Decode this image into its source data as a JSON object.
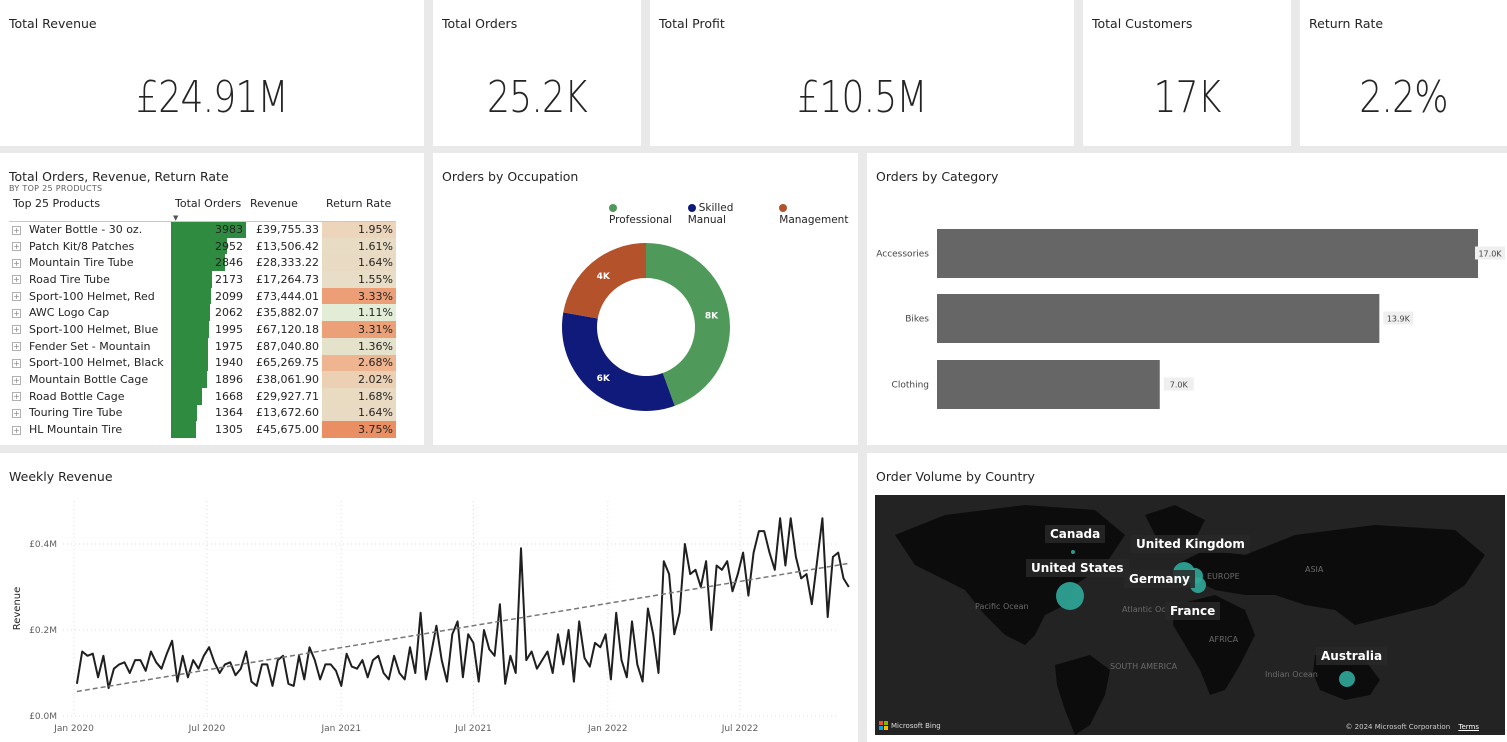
{
  "kpis": [
    {
      "title": "Total Revenue",
      "value": "£24.91M"
    },
    {
      "title": "Total Orders",
      "value": "25.2K"
    },
    {
      "title": "Total Profit",
      "value": "£10.5M"
    },
    {
      "title": "Total Customers",
      "value": "17K"
    },
    {
      "title": "Return Rate",
      "value": "2.2%"
    }
  ],
  "products_table": {
    "title": "Total Orders, Revenue, Return Rate",
    "subtitle": "BY TOP 25 PRODUCTS",
    "columns": [
      "Top 25 Products",
      "Total Orders",
      "Revenue",
      "Return Rate"
    ],
    "max_orders": 3983,
    "rows": [
      {
        "product": "Water Bottle - 30 oz.",
        "orders": 3983,
        "revenue": "£39,755.33",
        "return_rate": "1.95%",
        "rr_color": "#ecd5bb"
      },
      {
        "product": "Patch Kit/8 Patches",
        "orders": 2952,
        "revenue": "£13,506.42",
        "return_rate": "1.61%",
        "rr_color": "#e9dcc4"
      },
      {
        "product": "Mountain Tire Tube",
        "orders": 2846,
        "revenue": "£28,333.22",
        "return_rate": "1.64%",
        "rr_color": "#e9dbc3"
      },
      {
        "product": "Road Tire Tube",
        "orders": 2173,
        "revenue": "£17,264.73",
        "return_rate": "1.55%",
        "rr_color": "#e8ddc6"
      },
      {
        "product": "Sport-100 Helmet, Red",
        "orders": 2099,
        "revenue": "£73,444.01",
        "return_rate": "3.33%",
        "rr_color": "#ec9f77"
      },
      {
        "product": "AWC Logo Cap",
        "orders": 2062,
        "revenue": "£35,882.07",
        "return_rate": "1.11%",
        "rr_color": "#e2ecd6"
      },
      {
        "product": "Sport-100 Helmet, Blue",
        "orders": 1995,
        "revenue": "£67,120.18",
        "return_rate": "3.31%",
        "rr_color": "#eca078"
      },
      {
        "product": "Fender Set - Mountain",
        "orders": 1975,
        "revenue": "£87,040.80",
        "return_rate": "1.36%",
        "rr_color": "#e5e2cc"
      },
      {
        "product": "Sport-100 Helmet, Black",
        "orders": 1940,
        "revenue": "£65,269.75",
        "return_rate": "2.68%",
        "rr_color": "#eeb590"
      },
      {
        "product": "Mountain Bottle Cage",
        "orders": 1896,
        "revenue": "£38,061.90",
        "return_rate": "2.02%",
        "rr_color": "#ecd0b4"
      },
      {
        "product": "Road Bottle Cage",
        "orders": 1668,
        "revenue": "£29,927.71",
        "return_rate": "1.68%",
        "rr_color": "#e9dac2"
      },
      {
        "product": "Touring Tire Tube",
        "orders": 1364,
        "revenue": "£13,672.60",
        "return_rate": "1.64%",
        "rr_color": "#e9dbc3"
      },
      {
        "product": "HL Mountain Tire",
        "orders": 1305,
        "revenue": "£45,675.00",
        "return_rate": "3.75%",
        "rr_color": "#ea8f63"
      }
    ]
  },
  "occupation": {
    "title": "Orders by Occupation",
    "legend": [
      {
        "name": "Professional",
        "color": "#4f9a5a"
      },
      {
        "name": "Skilled Manual",
        "color": "#101a7a"
      },
      {
        "name": "Management",
        "color": "#b4522b"
      }
    ]
  },
  "category": {
    "title": "Orders by Category"
  },
  "weekly": {
    "title": "Weekly Revenue"
  },
  "map": {
    "title": "Order Volume by Country",
    "countries": [
      "Canada",
      "United Kingdom",
      "United States",
      "Germany",
      "France",
      "Australia"
    ],
    "faint_labels": [
      "EUROPE",
      "ASIA",
      "Pacific Ocean",
      "Atlantic Oc",
      "AFRICA",
      "SOUTH AMERICA",
      "Indian Ocean"
    ],
    "attribution": "© 2024 Microsoft Corporation",
    "terms": "Terms",
    "bing": "Microsoft Bing"
  },
  "chart_data": [
    {
      "type": "pie",
      "title": "Orders by Occupation",
      "categories": [
        "Professional",
        "Skilled Manual",
        "Management"
      ],
      "values": [
        8000,
        6000,
        4000
      ],
      "labels": [
        "8K",
        "6K",
        "4K"
      ],
      "colors": [
        "#4f9a5a",
        "#101a7a",
        "#b4522b"
      ],
      "donut": true
    },
    {
      "type": "bar",
      "orientation": "horizontal",
      "title": "Orders by Category",
      "categories": [
        "Accessories",
        "Bikes",
        "Clothing"
      ],
      "values": [
        17000,
        13900,
        7000
      ],
      "labels": [
        "17.0K",
        "13.9K",
        "7.0K"
      ],
      "color": "#666666",
      "xlim": [
        0,
        17000
      ]
    },
    {
      "type": "line",
      "title": "Weekly Revenue",
      "ylabel": "Revenue",
      "yticks": [
        "£0.0M",
        "£0.2M",
        "£0.4M"
      ],
      "ylim": [
        0,
        0.5
      ],
      "xticks": [
        {
          "label": "Jan 2020",
          "date": "2020-01-01"
        },
        {
          "label": "Jul 2020",
          "date": "2020-07-01"
        },
        {
          "label": "Jan 2021",
          "date": "2021-01-01"
        },
        {
          "label": "Jul 2021",
          "date": "2021-07-01"
        },
        {
          "label": "Jan 2022",
          "date": "2022-01-01"
        },
        {
          "label": "Jul 2022",
          "date": "2022-07-01"
        }
      ],
      "x_start": "2020-01-05",
      "x_end": "2022-11-27",
      "trend": {
        "start": 0.057,
        "end": 0.355
      },
      "values": [
        0.075,
        0.15,
        0.14,
        0.145,
        0.09,
        0.14,
        0.065,
        0.11,
        0.12,
        0.125,
        0.1,
        0.13,
        0.13,
        0.105,
        0.15,
        0.125,
        0.11,
        0.145,
        0.175,
        0.08,
        0.14,
        0.09,
        0.13,
        0.11,
        0.14,
        0.16,
        0.125,
        0.1,
        0.12,
        0.125,
        0.095,
        0.11,
        0.15,
        0.08,
        0.07,
        0.12,
        0.12,
        0.07,
        0.13,
        0.14,
        0.075,
        0.07,
        0.14,
        0.085,
        0.16,
        0.13,
        0.085,
        0.12,
        0.12,
        0.105,
        0.07,
        0.145,
        0.115,
        0.11,
        0.13,
        0.09,
        0.13,
        0.14,
        0.1,
        0.085,
        0.14,
        0.1,
        0.085,
        0.16,
        0.1,
        0.24,
        0.085,
        0.145,
        0.21,
        0.13,
        0.08,
        0.19,
        0.22,
        0.09,
        0.19,
        0.17,
        0.08,
        0.2,
        0.155,
        0.14,
        0.26,
        0.075,
        0.14,
        0.1,
        0.39,
        0.13,
        0.15,
        0.11,
        0.13,
        0.15,
        0.1,
        0.19,
        0.12,
        0.2,
        0.08,
        0.22,
        0.135,
        0.115,
        0.17,
        0.16,
        0.19,
        0.085,
        0.24,
        0.13,
        0.09,
        0.22,
        0.12,
        0.08,
        0.25,
        0.19,
        0.1,
        0.36,
        0.33,
        0.19,
        0.24,
        0.4,
        0.33,
        0.34,
        0.3,
        0.36,
        0.2,
        0.35,
        0.34,
        0.36,
        0.29,
        0.33,
        0.38,
        0.28,
        0.38,
        0.43,
        0.43,
        0.38,
        0.34,
        0.46,
        0.35,
        0.46,
        0.37,
        0.32,
        0.33,
        0.26,
        0.36,
        0.46,
        0.23,
        0.37,
        0.38,
        0.32,
        0.3
      ]
    }
  ]
}
